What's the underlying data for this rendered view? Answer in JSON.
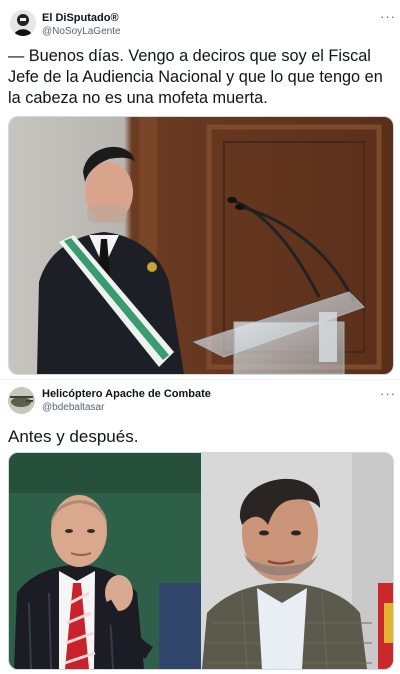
{
  "tweets": [
    {
      "author_name": "El DiSputado®",
      "author_handle": "@NoSoyLaGente",
      "more_label": "···",
      "text": "— Buenos días. Vengo a deciros que soy el Fiscal Jefe de la Audiencia Nacional y que lo que tengo en la cabeza no es una mofeta muerta."
    },
    {
      "author_name": "Helicóptero Apache de Combate",
      "author_handle": "@bdebaltasar",
      "more_label": "···",
      "text": "Antes y después."
    }
  ]
}
